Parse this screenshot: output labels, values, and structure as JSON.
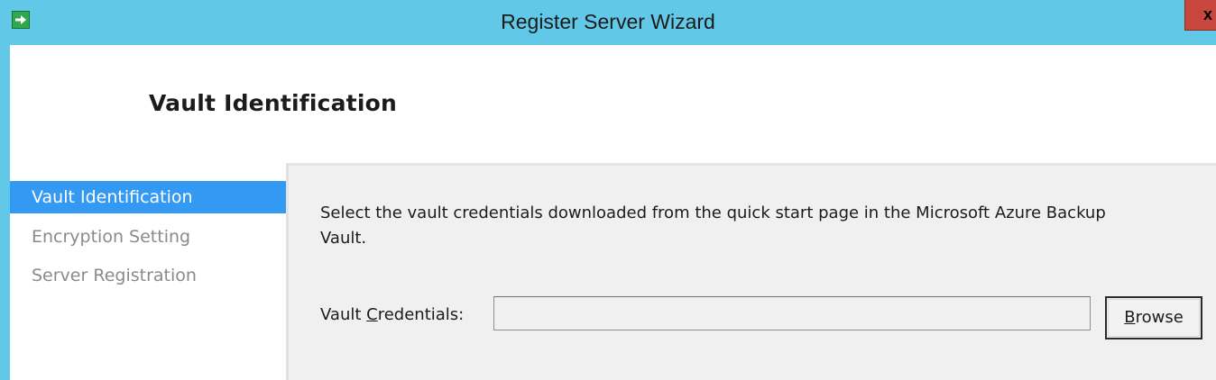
{
  "window": {
    "title": "Register Server Wizard",
    "close_label": "x",
    "app_icon": "green-arrow-icon"
  },
  "header": {
    "page_title": "Vault Identification"
  },
  "sidebar": {
    "steps": [
      {
        "label": "Vault Identification",
        "state": "active"
      },
      {
        "label": "Encryption Setting",
        "state": "inactive"
      },
      {
        "label": "Server Registration",
        "state": "inactive"
      }
    ]
  },
  "main": {
    "description": "Select the vault credentials downloaded from the quick start page in the Microsoft Azure Backup Vault.",
    "credentials_label_prefix": "Vault ",
    "credentials_label_accel": "C",
    "credentials_label_suffix": "redentials:",
    "credentials_value": "",
    "browse_accel": "B",
    "browse_rest": "rowse"
  },
  "colors": {
    "titlebar": "#62c8e8",
    "active_step": "#3399f3",
    "inactive_step_text": "#8a8a8a",
    "close_button": "#c7463e"
  }
}
